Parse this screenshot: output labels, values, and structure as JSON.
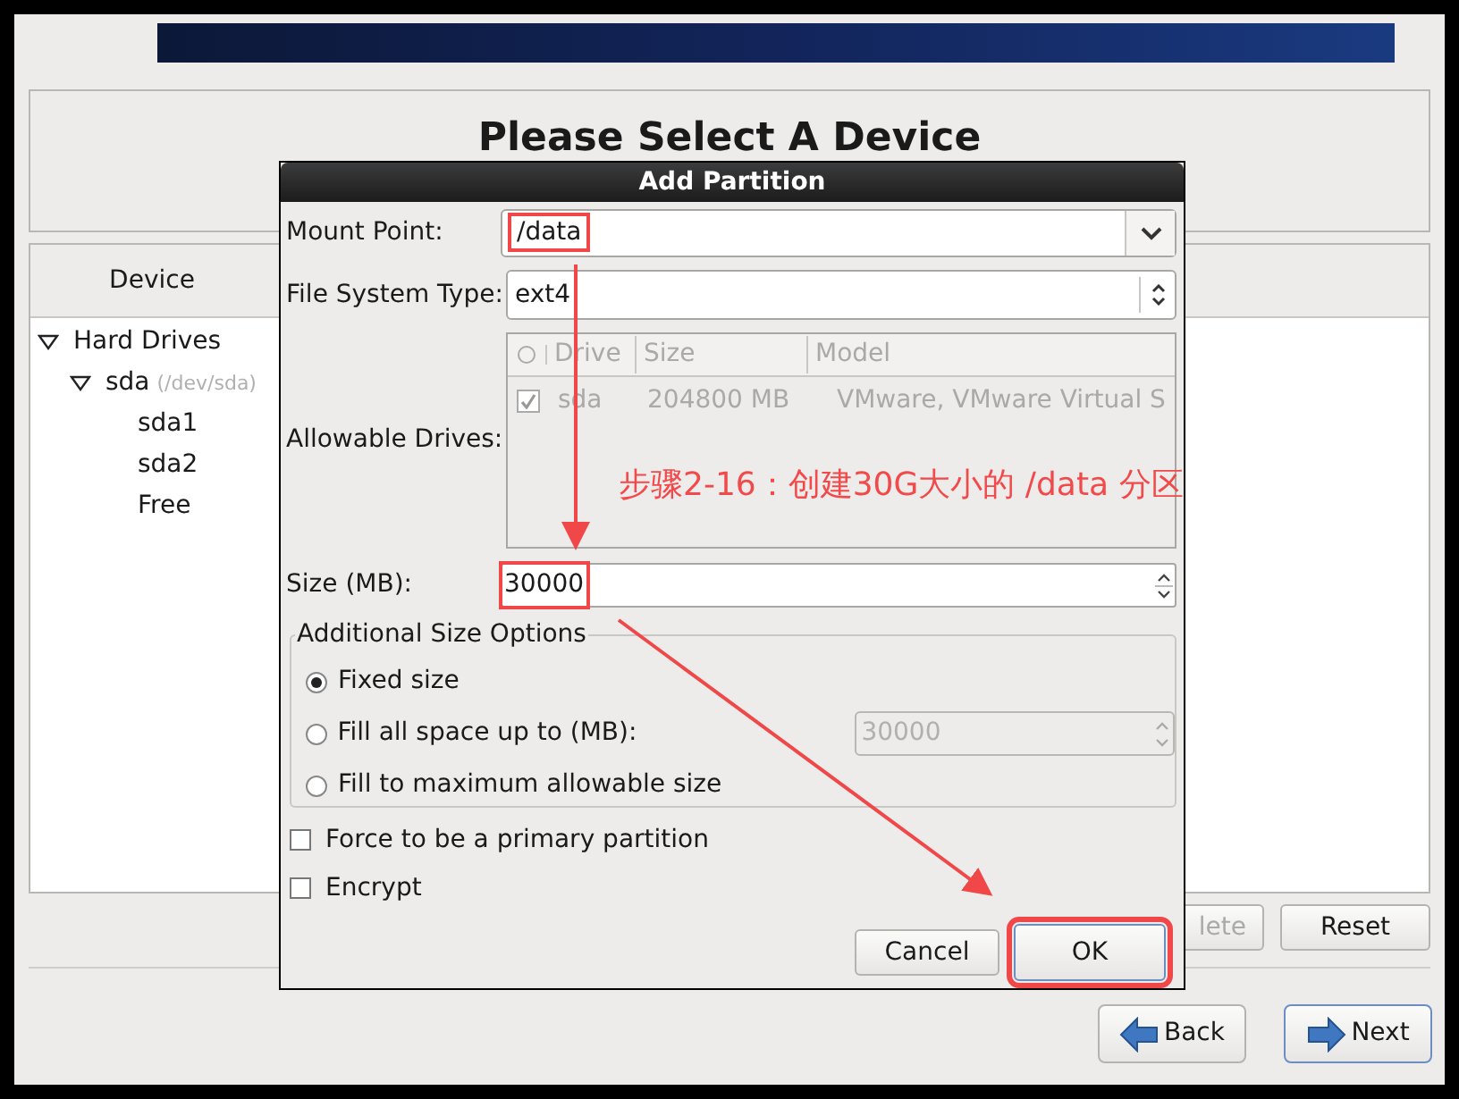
{
  "heading": "Please Select A Device",
  "device_panel": {
    "column": "Device",
    "tree": [
      {
        "label": "Hard Drives",
        "expanded": true,
        "children": [
          {
            "label": "sda",
            "detail": "(/dev/sda)",
            "expanded": true,
            "children": [
              {
                "label": "sda1"
              },
              {
                "label": "sda2"
              },
              {
                "label": "Free"
              }
            ]
          }
        ]
      }
    ]
  },
  "panel_buttons": [
    {
      "label": "lete",
      "disabled": true
    },
    {
      "label": "Reset",
      "disabled": false
    }
  ],
  "nav_buttons": [
    {
      "label": "Back",
      "kind": "back",
      "focused": false
    },
    {
      "label": "Next",
      "kind": "next",
      "focused": true
    }
  ],
  "dialog": {
    "title": "Add Partition",
    "mount_point": {
      "label": "Mount Point:",
      "value": "/data",
      "highlighted": true
    },
    "fs_type": {
      "label": "File System Type:",
      "value": "ext4"
    },
    "drives": {
      "label": "Allowable Drives:",
      "columns": [
        "Drive",
        "Size",
        "Model"
      ],
      "rows": [
        {
          "checked": true,
          "drive": "sda",
          "size": "204800 MB",
          "model": "VMware, VMware Virtual S"
        }
      ]
    },
    "size": {
      "label": "Size (MB):",
      "value": "30000",
      "highlighted": true
    },
    "size_options": {
      "title": "Additional Size Options",
      "options": [
        {
          "label": "Fixed size",
          "selected": true
        },
        {
          "label": "Fill all space up to (MB):",
          "selected": false,
          "value": "30000"
        },
        {
          "label": "Fill to maximum allowable size",
          "selected": false
        }
      ]
    },
    "checkboxes": [
      {
        "label": "Force to be a primary partition",
        "checked": false
      },
      {
        "label": "Encrypt",
        "checked": false
      }
    ],
    "buttons": [
      {
        "label": "Cancel",
        "highlighted": false
      },
      {
        "label": "OK",
        "highlighted": true
      }
    ]
  },
  "annotation": {
    "text": "步骤2-16：创建30G大小的 /data 分区"
  }
}
